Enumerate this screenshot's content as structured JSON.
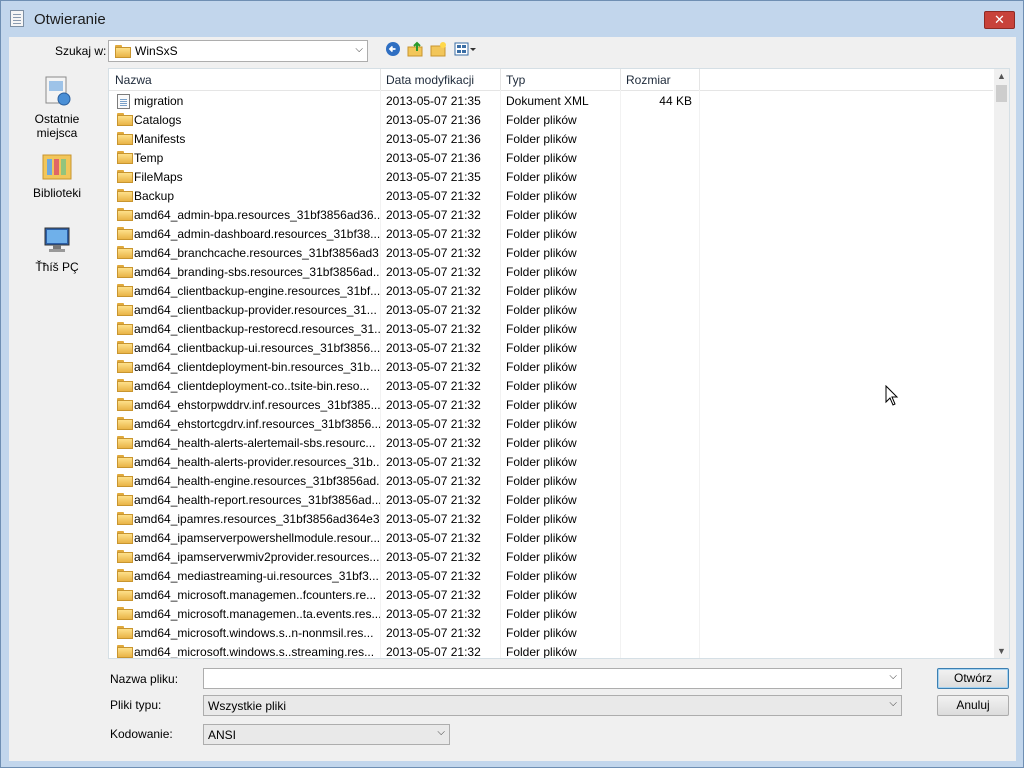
{
  "window": {
    "title": "Otwieranie",
    "close_glyph": "✕"
  },
  "toolbar": {
    "look_in_label": "Szukaj w:",
    "look_in_value": "WinSxS",
    "back_icon": "back-arrow-icon",
    "up_icon": "up-folder-icon",
    "new_folder_icon": "new-folder-icon",
    "views_icon": "view-menu-icon"
  },
  "places": [
    {
      "label_line1": "Ostatnie",
      "label_line2": "miejsca",
      "icon": "recent-places-icon"
    },
    {
      "label_line1": "Biblioteki",
      "label_line2": "",
      "icon": "libraries-icon"
    },
    {
      "label_line1": "Ťħíš PÇ",
      "label_line2": "",
      "icon": "this-pc-icon"
    }
  ],
  "columns": {
    "name": "Nazwa",
    "date": "Data modyfikacji",
    "type": "Typ",
    "size": "Rozmiar"
  },
  "files": [
    {
      "name": "migration",
      "date": "2013-05-07 21:35",
      "type": "Dokument XML",
      "size": "44 KB",
      "icon": "xml-file-icon"
    },
    {
      "name": "Catalogs",
      "date": "2013-05-07 21:36",
      "type": "Folder plików",
      "size": "",
      "icon": "folder-icon"
    },
    {
      "name": "Manifests",
      "date": "2013-05-07 21:36",
      "type": "Folder plików",
      "size": "",
      "icon": "folder-icon"
    },
    {
      "name": "Temp",
      "date": "2013-05-07 21:36",
      "type": "Folder plików",
      "size": "",
      "icon": "folder-icon"
    },
    {
      "name": "FileMaps",
      "date": "2013-05-07 21:35",
      "type": "Folder plików",
      "size": "",
      "icon": "folder-icon"
    },
    {
      "name": "Backup",
      "date": "2013-05-07 21:32",
      "type": "Folder plików",
      "size": "",
      "icon": "folder-icon"
    },
    {
      "name": "amd64_admin-bpa.resources_31bf3856ad36...",
      "date": "2013-05-07 21:32",
      "type": "Folder plików",
      "size": "",
      "icon": "folder-icon"
    },
    {
      "name": "amd64_admin-dashboard.resources_31bf38...",
      "date": "2013-05-07 21:32",
      "type": "Folder plików",
      "size": "",
      "icon": "folder-icon"
    },
    {
      "name": "amd64_branchcache.resources_31bf3856ad3...",
      "date": "2013-05-07 21:32",
      "type": "Folder plików",
      "size": "",
      "icon": "folder-icon"
    },
    {
      "name": "amd64_branding-sbs.resources_31bf3856ad...",
      "date": "2013-05-07 21:32",
      "type": "Folder plików",
      "size": "",
      "icon": "folder-icon"
    },
    {
      "name": "amd64_clientbackup-engine.resources_31bf...",
      "date": "2013-05-07 21:32",
      "type": "Folder plików",
      "size": "",
      "icon": "folder-icon"
    },
    {
      "name": "amd64_clientbackup-provider.resources_31...",
      "date": "2013-05-07 21:32",
      "type": "Folder plików",
      "size": "",
      "icon": "folder-icon"
    },
    {
      "name": "amd64_clientbackup-restorecd.resources_31...",
      "date": "2013-05-07 21:32",
      "type": "Folder plików",
      "size": "",
      "icon": "folder-icon"
    },
    {
      "name": "amd64_clientbackup-ui.resources_31bf3856...",
      "date": "2013-05-07 21:32",
      "type": "Folder plików",
      "size": "",
      "icon": "folder-icon"
    },
    {
      "name": "amd64_clientdeployment-bin.resources_31b...",
      "date": "2013-05-07 21:32",
      "type": "Folder plików",
      "size": "",
      "icon": "folder-icon"
    },
    {
      "name": "amd64_clientdeployment-co..tsite-bin.reso...",
      "date": "2013-05-07 21:32",
      "type": "Folder plików",
      "size": "",
      "icon": "folder-icon"
    },
    {
      "name": "amd64_ehstorpwddrv.inf.resources_31bf385...",
      "date": "2013-05-07 21:32",
      "type": "Folder plików",
      "size": "",
      "icon": "folder-icon"
    },
    {
      "name": "amd64_ehstortcgdrv.inf.resources_31bf3856...",
      "date": "2013-05-07 21:32",
      "type": "Folder plików",
      "size": "",
      "icon": "folder-icon"
    },
    {
      "name": "amd64_health-alerts-alertemail-sbs.resourc...",
      "date": "2013-05-07 21:32",
      "type": "Folder plików",
      "size": "",
      "icon": "folder-icon"
    },
    {
      "name": "amd64_health-alerts-provider.resources_31b...",
      "date": "2013-05-07 21:32",
      "type": "Folder plików",
      "size": "",
      "icon": "folder-icon"
    },
    {
      "name": "amd64_health-engine.resources_31bf3856ad...",
      "date": "2013-05-07 21:32",
      "type": "Folder plików",
      "size": "",
      "icon": "folder-icon"
    },
    {
      "name": "amd64_health-report.resources_31bf3856ad...",
      "date": "2013-05-07 21:32",
      "type": "Folder plików",
      "size": "",
      "icon": "folder-icon"
    },
    {
      "name": "amd64_ipamres.resources_31bf3856ad364e3...",
      "date": "2013-05-07 21:32",
      "type": "Folder plików",
      "size": "",
      "icon": "folder-icon"
    },
    {
      "name": "amd64_ipamserverpowershellmodule.resour...",
      "date": "2013-05-07 21:32",
      "type": "Folder plików",
      "size": "",
      "icon": "folder-icon"
    },
    {
      "name": "amd64_ipamserverwmiv2provider.resources...",
      "date": "2013-05-07 21:32",
      "type": "Folder plików",
      "size": "",
      "icon": "folder-icon"
    },
    {
      "name": "amd64_mediastreaming-ui.resources_31bf3...",
      "date": "2013-05-07 21:32",
      "type": "Folder plików",
      "size": "",
      "icon": "folder-icon"
    },
    {
      "name": "amd64_microsoft.managemen..fcounters.re...",
      "date": "2013-05-07 21:32",
      "type": "Folder plików",
      "size": "",
      "icon": "folder-icon"
    },
    {
      "name": "amd64_microsoft.managemen..ta.events.res...",
      "date": "2013-05-07 21:32",
      "type": "Folder plików",
      "size": "",
      "icon": "folder-icon"
    },
    {
      "name": "amd64_microsoft.windows.s..n-nonmsil.res...",
      "date": "2013-05-07 21:32",
      "type": "Folder plików",
      "size": "",
      "icon": "folder-icon"
    },
    {
      "name": "amd64_microsoft.windows.s..streaming.res...",
      "date": "2013-05-07 21:32",
      "type": "Folder plików",
      "size": "",
      "icon": "folder-icon"
    }
  ],
  "bottom": {
    "filename_label": "Nazwa pliku:",
    "filename_value": "",
    "filetype_label": "Pliki typu:",
    "filetype_value": "Wszystkie pliki",
    "encoding_label": "Kodowanie:",
    "encoding_value": "ANSI",
    "open_button": "Otwórz",
    "cancel_button": "Anuluj"
  }
}
